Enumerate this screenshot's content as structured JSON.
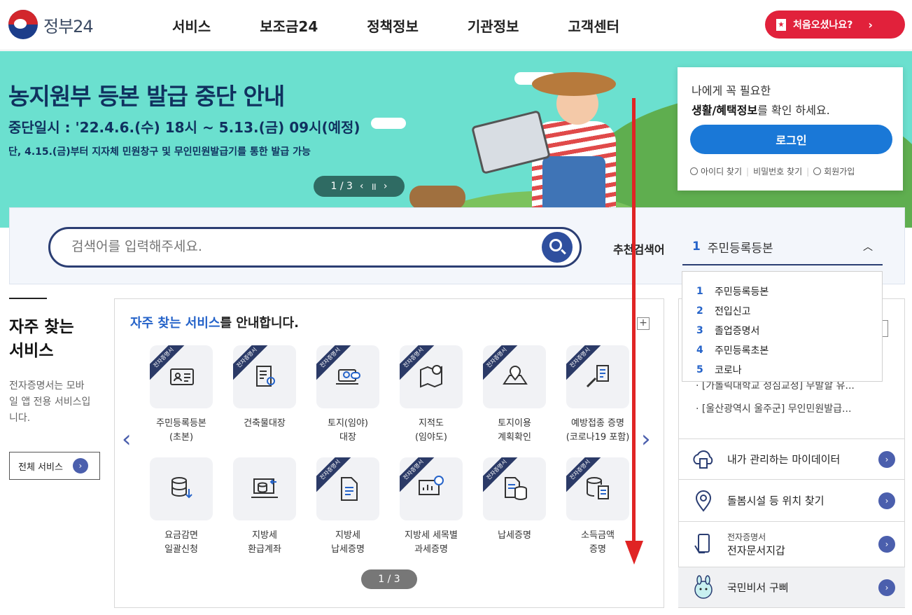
{
  "header": {
    "logo_text": "정부24",
    "nav": [
      "서비스",
      "보조금24",
      "정책정보",
      "기관정보",
      "고객센터"
    ],
    "first_visit_label": "처음오셨나요?"
  },
  "banner": {
    "title": "농지원부 등본 발급 중단 안내",
    "date": "중단일시 : '22.4.6.(수) 18시 ~ 5.13.(금) 09시(예정)",
    "note": "단, 4.15.(금)부터 지자체 민원창구 및 무인민원발급기를 통한 발급 가능",
    "pager": "1 / 3"
  },
  "login": {
    "line1": "나에게 꼭 필요한",
    "line2_bold": "생활/혜택정보",
    "line2_rest": "를 확인 하세요.",
    "button": "로그인",
    "links": [
      "아이디 찾기",
      "비밀번호 찾기",
      "회원가입"
    ]
  },
  "search": {
    "placeholder": "검색어를 입력해주세요.",
    "rec_label": "추천검색어",
    "current_num": "1",
    "current_term": "주민등록등본",
    "dropdown": [
      {
        "n": "1",
        "term": "주민등록등본"
      },
      {
        "n": "2",
        "term": "전입신고"
      },
      {
        "n": "3",
        "term": "졸업증명서"
      },
      {
        "n": "4",
        "term": "주민등록초본"
      },
      {
        "n": "5",
        "term": "코로나"
      }
    ]
  },
  "left": {
    "title": "자주 찾는 서비스",
    "desc": "전자증명서는 모바일 앱 전용 서비스입니다.",
    "all_button": "전체 서비스"
  },
  "services": {
    "heading_hl": "자주 찾는 서비스",
    "heading_rest": "를 안내합니다.",
    "ribbon": "전자증명서",
    "pager": "1 / 3",
    "items": [
      {
        "label": "주민등록등본\n(초본)",
        "ribbon": true,
        "icon": "id-card-icon"
      },
      {
        "label": "건축물대장",
        "ribbon": true,
        "icon": "document-search-icon"
      },
      {
        "label": "토지(임야)\n대장",
        "ribbon": true,
        "icon": "land-laptop-icon"
      },
      {
        "label": "지적도\n(임야도)",
        "ribbon": true,
        "icon": "map-search-icon"
      },
      {
        "label": "토지이용\n계획확인",
        "ribbon": true,
        "icon": "map-pin-icon"
      },
      {
        "label": "예방접종 증명\n(코로나19 포함)",
        "ribbon": true,
        "icon": "syringe-icon"
      },
      {
        "label": "요금감면\n일괄신청",
        "ribbon": false,
        "icon": "database-download-icon"
      },
      {
        "label": "지방세\n환급계좌",
        "ribbon": false,
        "icon": "laptop-database-icon"
      },
      {
        "label": "지방세\n납세증명",
        "ribbon": true,
        "icon": "document-icon"
      },
      {
        "label": "지방세 세목별\n과세증명",
        "ribbon": true,
        "icon": "presentation-search-icon"
      },
      {
        "label": "납세증명",
        "ribbon": true,
        "icon": "document-database-icon"
      },
      {
        "label": "소득금액\n증명",
        "ribbon": true,
        "icon": "database-document-icon"
      }
    ]
  },
  "right": {
    "news": [
      "[가톨릭대학교 성심교정] 무발할 유...",
      "[울산광역시 울주군] 무인민원발급..."
    ],
    "quick": [
      {
        "label": "내가 관리하는 마이데이터",
        "small": ""
      },
      {
        "label": "돌봄시설 등 위치 찾기",
        "small": ""
      },
      {
        "label": "전자문서지갑",
        "small": "전자증명서"
      },
      {
        "label": "국민비서 구삐",
        "small": ""
      }
    ]
  },
  "colors": {
    "accent": "#2563c9",
    "brand_red": "#e1213b",
    "banner_bg": "#6be0cf",
    "navy": "#2b3e73"
  }
}
